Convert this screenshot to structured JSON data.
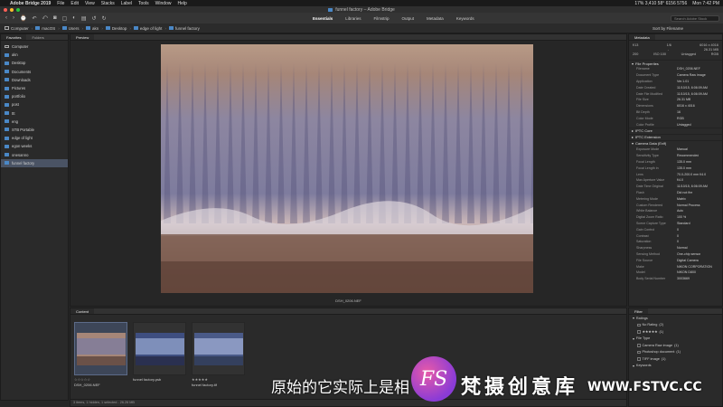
{
  "menubar": {
    "app_name": "Adobe Bridge 2019",
    "items": [
      "File",
      "Edit",
      "View",
      "Stacks",
      "Label",
      "Tools",
      "Window",
      "Help"
    ],
    "status": "17%  3,410 58° 6156 5756",
    "clock": "Mon 7:42 PM"
  },
  "window": {
    "title": "funnel factory – Adobe Bridge"
  },
  "toolbar": {
    "workspaces": [
      "Essentials",
      "Libraries",
      "Filmstrip",
      "Output",
      "Metadata",
      "Keywords"
    ],
    "active_workspace": "Essentials",
    "search_placeholder": "Search Adobe Stock"
  },
  "path": {
    "crumbs": [
      "Computer",
      "macOS",
      "Users",
      "akn",
      "Desktop",
      "edge of light",
      "funnel factory"
    ],
    "sort_label": "Sort by Filename"
  },
  "favorites": {
    "tabs": [
      "Favorites",
      "Folders"
    ],
    "items": [
      {
        "label": "Computer",
        "icon": "computer-icon"
      },
      {
        "label": "akn",
        "icon": "folder-icon"
      },
      {
        "label": "Desktop",
        "icon": "folder-icon"
      },
      {
        "label": "Documents",
        "icon": "folder-icon"
      },
      {
        "label": "Downloads",
        "icon": "folder-icon"
      },
      {
        "label": "Pictures",
        "icon": "folder-icon"
      },
      {
        "label": "portfolio",
        "icon": "folder-icon"
      },
      {
        "label": "post",
        "icon": "folder-icon"
      },
      {
        "label": "ttt",
        "icon": "folder-icon"
      },
      {
        "label": "eng",
        "icon": "folder-icon"
      },
      {
        "label": "STB Portable",
        "icon": "folder-icon"
      },
      {
        "label": "edge of light",
        "icon": "folder-icon"
      },
      {
        "label": "egon weeks",
        "icon": "folder-icon"
      },
      {
        "label": "onesanno",
        "icon": "folder-icon"
      },
      {
        "label": "funnel factory",
        "icon": "folder-icon",
        "selected": true
      }
    ]
  },
  "preview": {
    "tab": "Preview",
    "caption": "DSH_0206.NEF"
  },
  "content": {
    "tab": "Content",
    "thumbs": [
      {
        "stars": "☆☆☆☆☆",
        "name": "DSH_0206.NEF",
        "selected": true
      },
      {
        "stars": "",
        "name": "funnel factory.psb"
      },
      {
        "stars": "★★★★★",
        "name": "funnel factory.tif"
      }
    ],
    "status": "3 items, 1 hidden, 1 selected - 26.26 MB"
  },
  "metadata": {
    "tab": "Metadata",
    "head": [
      [
        "f/13",
        "1/6",
        "6016 x 4016"
      ],
      [
        "",
        "-",
        "26.31 MB"
      ],
      [
        "",
        "200",
        "ISO 100",
        "Untagged",
        "RGB"
      ]
    ],
    "sections": [
      {
        "title": "File Properties",
        "rows": [
          [
            "Filename",
            "DSH_0206.NEF"
          ],
          [
            "Document Type",
            "Camera Raw image"
          ],
          [
            "Application",
            "Ver.1.01"
          ],
          [
            "Date Created",
            "11/10/15, 6:06:09 AM"
          ],
          [
            "Date File Modified",
            "11/10/15, 6:06:09 AM"
          ],
          [
            "File Size",
            "26.31 MB"
          ],
          [
            "Dimensions",
            "6016 x 4016"
          ],
          [
            "Bit Depth",
            "16"
          ],
          [
            "Color Mode",
            "RGB"
          ],
          [
            "Color Profile",
            "Untagged"
          ]
        ]
      },
      {
        "title": "IPTC Core",
        "rows": []
      },
      {
        "title": "IPTC Extension",
        "rows": []
      },
      {
        "title": "Camera Data (Exif)",
        "rows": [
          [
            "Exposure Mode",
            "Manual"
          ],
          [
            "Sensitivity Type",
            "Recommended"
          ],
          [
            "Focal Length",
            "135.0 mm"
          ],
          [
            "Focal Length in",
            "135.0 mm"
          ],
          [
            "Lens",
            "70.0-200.0 mm f/4.0"
          ],
          [
            "Max Aperture Value",
            "f/4.0"
          ],
          [
            "Date Time Original",
            "11/10/15, 6:06:09 AM"
          ],
          [
            "Flash",
            "Did not fire"
          ],
          [
            "Metering Mode",
            "Matrix"
          ],
          [
            "Custom Rendered",
            "Normal Process"
          ],
          [
            "White Balance",
            "Auto"
          ],
          [
            "Digital Zoom Ratio",
            "100 %"
          ],
          [
            "Scene Capture Type",
            "Standard"
          ],
          [
            "Gain Control",
            "0"
          ],
          [
            "Contrast",
            "0"
          ],
          [
            "Saturation",
            "0"
          ],
          [
            "Sharpness",
            "Normal"
          ],
          [
            "Sensing Method",
            "One-chip sensor"
          ],
          [
            "File Source",
            "Digital Camera"
          ],
          [
            "Make",
            "NIKON CORPORATION"
          ],
          [
            "Model",
            "NIKON D800"
          ],
          [
            "Body Serial Number",
            "3003669"
          ]
        ]
      }
    ]
  },
  "filter": {
    "tab": "Filter",
    "rows": [
      {
        "label": "Ratings",
        "type": "section"
      },
      {
        "label": "No Rating",
        "count": "(2)",
        "type": "item"
      },
      {
        "label": "★★★★★",
        "count": "(1)",
        "type": "item"
      },
      {
        "label": "File Type",
        "type": "section"
      },
      {
        "label": "Camera Raw image",
        "count": "(1)",
        "type": "item"
      },
      {
        "label": "Photoshop document",
        "count": "(1)",
        "type": "item"
      },
      {
        "label": "TIFF image",
        "count": "(1)",
        "type": "item"
      },
      {
        "label": "Keywords",
        "type": "section"
      }
    ]
  },
  "overlay": {
    "subtitle": "原始的它实际上是相",
    "logo_letter": "FS",
    "brand": "梵摄创意库",
    "url": "WWW.FSTVC.CC"
  },
  "colors": {
    "accent": "#4a88c7",
    "selection": "#4a5364",
    "logo": "#8a3bd6"
  }
}
